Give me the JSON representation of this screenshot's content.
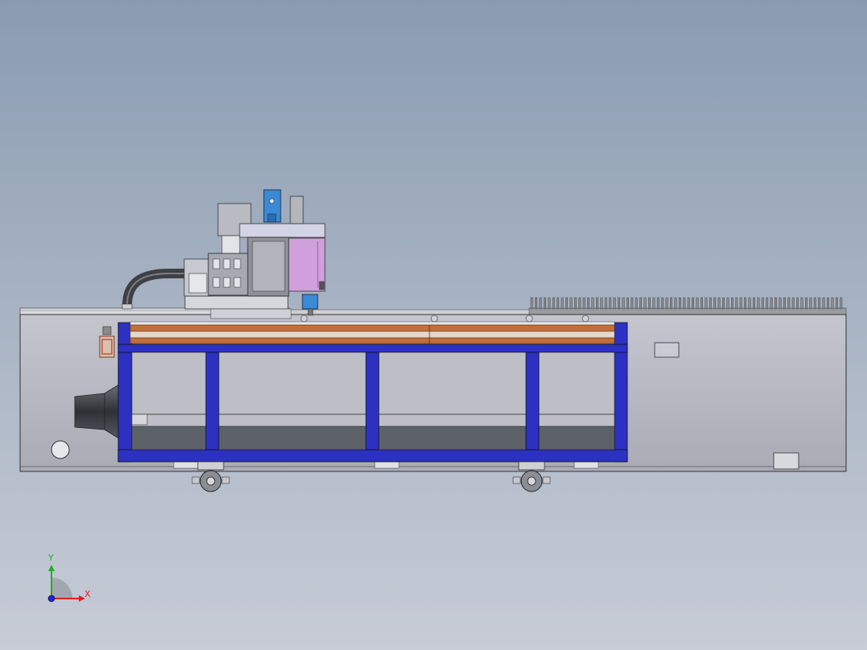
{
  "viewport": {
    "background_top": "#8a9bb1",
    "background_bottom": "#c7ccd6"
  },
  "colors": {
    "frame_blue": "#2c31c4",
    "frame_blue_dark": "#1a1e8a",
    "wood": "#c26f3a",
    "bed_gray": "#b9bac3",
    "inner_dark": "#5d6168",
    "spindle_blue": "#3a8ad6",
    "motor_lavender": "#d0a0dc",
    "rack_gray": "#8a8c92"
  },
  "machine": {
    "name_icon": "cnc-router-machine",
    "cross_posts": 4,
    "casters": 2,
    "rack_teeth": 72
  },
  "triad": {
    "x_label": "X",
    "y_label": "Y",
    "x_color": "#e02020",
    "y_color": "#20b020",
    "z_color": "#2020e0"
  }
}
